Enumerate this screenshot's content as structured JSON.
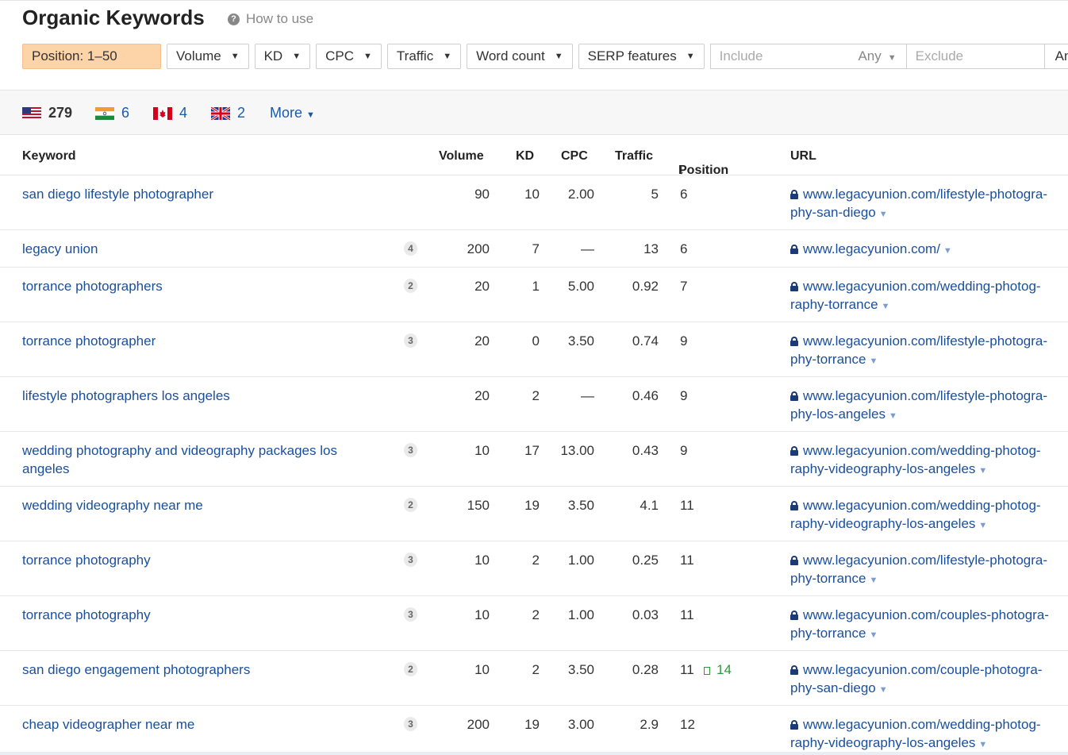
{
  "header": {
    "title": "Organic Keywords",
    "how_to_use": "How to use"
  },
  "filters": {
    "position": "Position: 1–50",
    "volume": "Volume",
    "kd": "KD",
    "cpc": "CPC",
    "traffic": "Traffic",
    "word_count": "Word count",
    "serp_features": "SERP features",
    "include_placeholder": "Include",
    "any": "Any",
    "exclude_placeholder": "Exclude",
    "an": "An"
  },
  "countries": [
    {
      "flag": "us-flag-icon",
      "count": "279"
    },
    {
      "flag": "in-flag-icon",
      "count": "6"
    },
    {
      "flag": "ca-flag-icon",
      "count": "4"
    },
    {
      "flag": "gb-flag-icon",
      "count": "2"
    }
  ],
  "more_label": "More",
  "columns": {
    "keyword": "Keyword",
    "volume": "Volume",
    "kd": "KD",
    "cpc": "CPC",
    "traffic": "Traffic",
    "position": "Position",
    "url": "URL"
  },
  "rows": [
    {
      "keyword": "san diego lifestyle photographer",
      "badge": "",
      "volume": "90",
      "kd": "10",
      "cpc": "2.00",
      "traffic": "5",
      "position": "6",
      "change": "",
      "url_l1": "www.legacyunion.com/lifestyle-photogra-",
      "url_l2": "phy-san-diego"
    },
    {
      "keyword": "legacy union",
      "badge": "4",
      "volume": "200",
      "kd": "7",
      "cpc": "—",
      "traffic": "13",
      "position": "6",
      "change": "",
      "url_l1": "www.legacyunion.com/",
      "url_l2": ""
    },
    {
      "keyword": "torrance photographers",
      "badge": "2",
      "volume": "20",
      "kd": "1",
      "cpc": "5.00",
      "traffic": "0.92",
      "position": "7",
      "change": "",
      "url_l1": "www.legacyunion.com/wedding-photog-",
      "url_l2": "raphy-torrance"
    },
    {
      "keyword": "torrance photographer",
      "badge": "3",
      "volume": "20",
      "kd": "0",
      "cpc": "3.50",
      "traffic": "0.74",
      "position": "9",
      "change": "",
      "url_l1": "www.legacyunion.com/lifestyle-photogra-",
      "url_l2": "phy-torrance"
    },
    {
      "keyword": "lifestyle photographers los angeles",
      "badge": "",
      "volume": "20",
      "kd": "2",
      "cpc": "—",
      "traffic": "0.46",
      "position": "9",
      "change": "",
      "url_l1": "www.legacyunion.com/lifestyle-photogra-",
      "url_l2": "phy-los-angeles"
    },
    {
      "keyword": "wedding photography and videography packages los angeles",
      "badge": "3",
      "volume": "10",
      "kd": "17",
      "cpc": "13.00",
      "traffic": "0.43",
      "position": "9",
      "change": "",
      "url_l1": "www.legacyunion.com/wedding-photog-",
      "url_l2": "raphy-videography-los-angeles"
    },
    {
      "keyword": "wedding videography near me",
      "badge": "2",
      "volume": "150",
      "kd": "19",
      "cpc": "3.50",
      "traffic": "4.1",
      "position": "11",
      "change": "",
      "url_l1": "www.legacyunion.com/wedding-photog-",
      "url_l2": "raphy-videography-los-angeles"
    },
    {
      "keyword": "torrance photography",
      "badge": "3",
      "volume": "10",
      "kd": "2",
      "cpc": "1.00",
      "traffic": "0.25",
      "position": "11",
      "change": "",
      "url_l1": "www.legacyunion.com/lifestyle-photogra-",
      "url_l2": "phy-torrance"
    },
    {
      "keyword": "torrance photography",
      "badge": "3",
      "volume": "10",
      "kd": "2",
      "cpc": "1.00",
      "traffic": "0.03",
      "position": "11",
      "change": "",
      "url_l1": "www.legacyunion.com/couples-photogra-",
      "url_l2": "phy-torrance"
    },
    {
      "keyword": "san diego engagement photographers",
      "badge": "2",
      "volume": "10",
      "kd": "2",
      "cpc": "3.50",
      "traffic": "0.28",
      "position": "11",
      "change": "14",
      "url_l1": "www.legacyunion.com/couple-photogra-",
      "url_l2": "phy-san-diego"
    },
    {
      "keyword": "cheap videographer near me",
      "badge": "3",
      "volume": "200",
      "kd": "19",
      "cpc": "3.00",
      "traffic": "2.9",
      "position": "12",
      "change": "",
      "url_l1": "www.legacyunion.com/wedding-photog-",
      "url_l2": "raphy-videography-los-angeles"
    }
  ]
}
